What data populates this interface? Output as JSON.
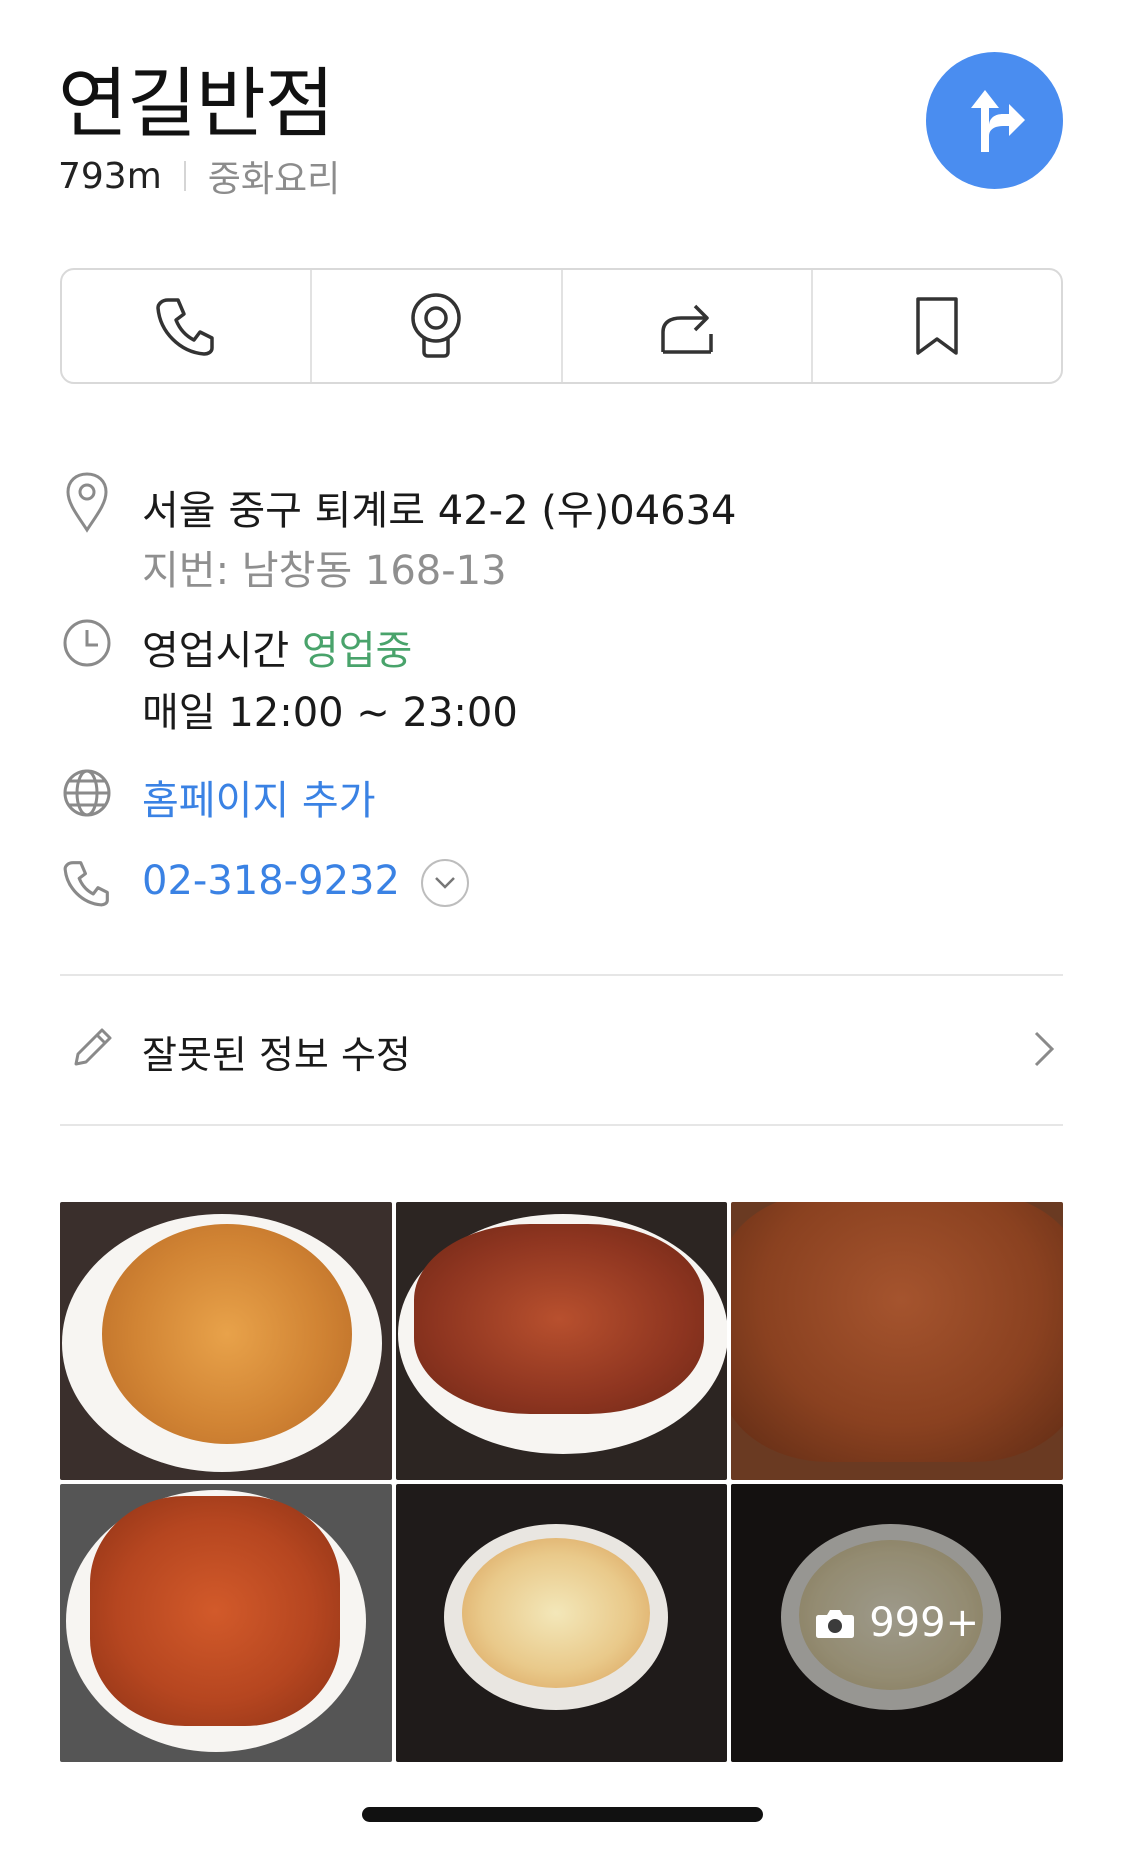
{
  "place": {
    "name": "연길반점",
    "distance": "793m",
    "category": "중화요리"
  },
  "actions": [
    {
      "icon": "phone-icon"
    },
    {
      "icon": "map-pin-icon"
    },
    {
      "icon": "share-icon"
    },
    {
      "icon": "bookmark-icon"
    }
  ],
  "address": {
    "road": "서울 중구 퇴계로 42-2 (우)04634",
    "lot": "지번: 남창동 168-13"
  },
  "hours": {
    "label": "영업시간",
    "status": "영업중",
    "schedule": "매일 12:00 ~ 23:00"
  },
  "homepage": {
    "label": "홈페이지 추가"
  },
  "phone": {
    "number": "02-318-9232"
  },
  "edit": {
    "label": "잘못된 정보 수정"
  },
  "photos": {
    "more_label": "999+"
  },
  "colors": {
    "accent_blue": "#3a82e4",
    "direction_button": "#4a8df0",
    "open_green": "#49a36b"
  }
}
